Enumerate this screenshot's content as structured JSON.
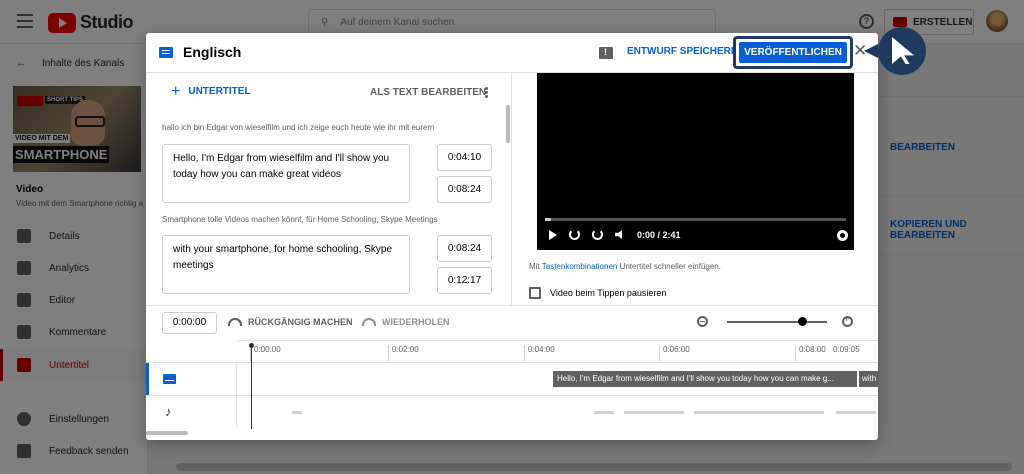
{
  "topbar": {
    "app_name": "Studio",
    "search_placeholder": "Auf deinem Kanal suchen",
    "create_label": "ERSTELLEN"
  },
  "sidebar": {
    "back_label": "Inhalte des Kanals",
    "thumbnail_tag": "SHORT TIPS",
    "thumbnail_line1": "VIDEO MIT DEM",
    "thumbnail_line2": "SMARTPHONE",
    "video_heading": "Video",
    "video_title": "Video mit dem Smartphone richtig a",
    "items": [
      {
        "label": "Details",
        "icon": "pencil-icon"
      },
      {
        "label": "Analytics",
        "icon": "bar-chart-icon"
      },
      {
        "label": "Editor",
        "icon": "film-icon"
      },
      {
        "label": "Kommentare",
        "icon": "comment-icon"
      },
      {
        "label": "Untertitel",
        "icon": "subtitles-icon",
        "active": true
      }
    ],
    "settings_label": "Einstellungen",
    "feedback_label": "Feedback senden"
  },
  "background": {
    "edit_link": "BEARBEITEN",
    "copy_edit_link": "KOPIEREN UND BEARBEITEN"
  },
  "dialog": {
    "title": "Englisch",
    "draft_label": "ENTWURF SPEICHERN",
    "publish_label": "VERÖFFENTLICHEN",
    "close_symbol": "✕",
    "add_subtitle_label": "UNTERTITEL",
    "edit_as_text_label": "ALS TEXT BEARBEITEN",
    "cues": [
      {
        "source": "hallo ich bin Edgar von wieselfilm und ich zeige euch heute wie ihr mit eurem",
        "text": "Hello, I'm Edgar from wieselfilm and I'll show you today how you can make great videos",
        "start": "0:04:10",
        "end": "0:08:24"
      },
      {
        "source": "Smartphone tolle Videos machen könnt, für Home Schooling, Skype Meetings",
        "text": "with your smartphone, for home schooling, Skype meetings",
        "start": "0:08:24",
        "end": "0:12:17"
      }
    ],
    "player": {
      "time_display": "0:00 / 2:41",
      "progress": 0.02
    },
    "hint_prefix": "Mit ",
    "hint_link": "Tastenkombinationen",
    "hint_suffix": " Untertitel schneller einfügen.",
    "pause_label": "Video beim Tippen pausieren",
    "timeline": {
      "timecode": "0:00:00",
      "undo_label": "RÜCKGÄNGIG MACHEN",
      "redo_label": "WIEDERHOLEN",
      "zoom_level": 0.75,
      "ticks": [
        "0:00:00",
        "0:02:00",
        "0:04:00",
        "0:06:00",
        "0:08:00",
        "0:09:05"
      ],
      "caption_1": "Hello, I'm Edgar from wieselfilm and I'll show you today how you can make g...",
      "caption_2": "with"
    }
  }
}
